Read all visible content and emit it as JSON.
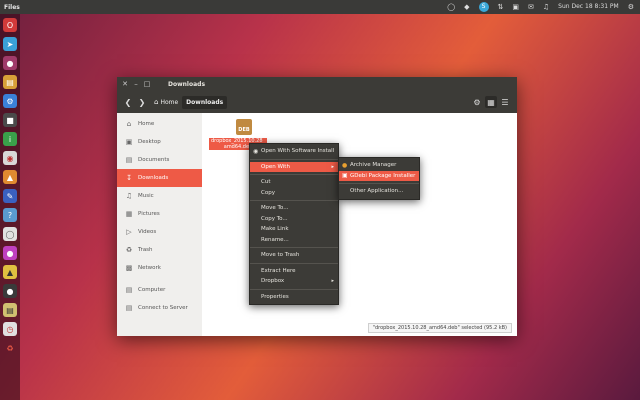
{
  "topbar": {
    "app_name": "Files",
    "clock": "Sun Dec 18  8:31 PM"
  },
  "window": {
    "title": "Downloads",
    "path": {
      "home_label": "Home",
      "current_label": "Downloads"
    }
  },
  "sidebar": {
    "items": [
      {
        "label": "Home",
        "icon": "home-icon"
      },
      {
        "label": "Desktop",
        "icon": "desktop-icon"
      },
      {
        "label": "Documents",
        "icon": "documents-icon"
      },
      {
        "label": "Downloads",
        "icon": "downloads-icon",
        "active": true
      },
      {
        "label": "Music",
        "icon": "music-icon"
      },
      {
        "label": "Pictures",
        "icon": "pictures-icon"
      },
      {
        "label": "Videos",
        "icon": "videos-icon"
      },
      {
        "label": "Trash",
        "icon": "trash-icon"
      },
      {
        "label": "Network",
        "icon": "network-icon"
      },
      {
        "label": "Computer",
        "icon": "computer-icon"
      },
      {
        "label": "Connect to Server",
        "icon": "server-icon"
      }
    ]
  },
  "file": {
    "icon_text": "DEB",
    "name_line1": "dropbox_2015.10.28_",
    "name_line2": "amd64.deb"
  },
  "statusbar": {
    "text": "\"dropbox_2015.10.28_amd64.deb\" selected  (95.2 kB)"
  },
  "context_menu": {
    "open_with_software": "Open With Software Install",
    "open_with": "Open With",
    "cut": "Cut",
    "copy": "Copy",
    "move_to": "Move To...",
    "copy_to": "Copy To...",
    "make_link": "Make Link",
    "rename": "Rename...",
    "move_to_trash": "Move to Trash",
    "extract_here": "Extract Here",
    "dropbox": "Dropbox",
    "properties": "Properties"
  },
  "submenu": {
    "archive_manager": "Archive Manager",
    "gdebi": "GDebi Package Installer",
    "other_app": "Other Application..."
  },
  "colors": {
    "accent": "#ee5a46",
    "menu_bg": "#3c3b37"
  }
}
